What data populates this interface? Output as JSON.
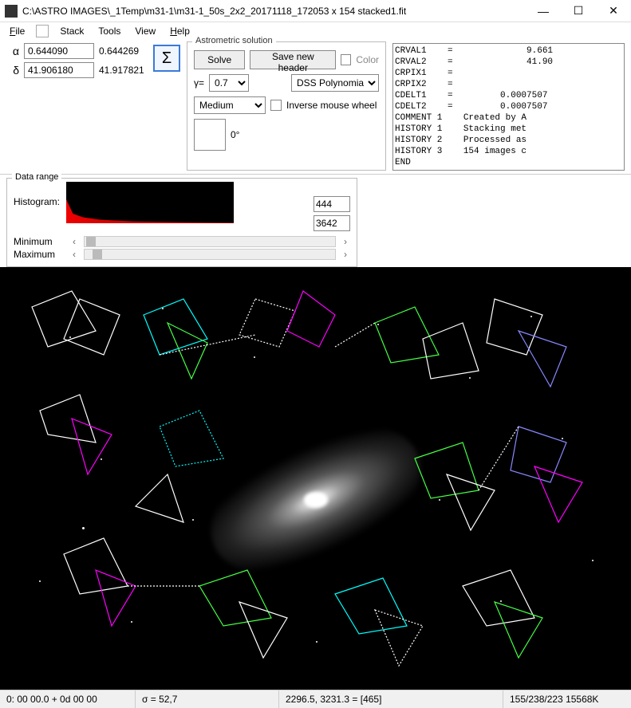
{
  "window": {
    "title": "C:\\ASTRO IMAGES\\_1Temp\\m31-1\\m31-1_50s_2x2_20171118_172053 x 154 stacked1.fit"
  },
  "menu": {
    "file": "File",
    "stack": "Stack",
    "tools": "Tools",
    "view": "View",
    "help": "Help"
  },
  "coords": {
    "alpha_sym": "α",
    "alpha_input": "0.644090",
    "alpha_val": "0.644269",
    "delta_sym": "δ",
    "delta_input": "41.906180",
    "delta_val": "41.917821"
  },
  "sigma": "Σ",
  "astro": {
    "legend": "Astrometric solution",
    "solve": "Solve",
    "save_header": "Save new header",
    "color": "Color",
    "fit_type": "DSS Polynomial",
    "gamma_label": "γ=",
    "gamma_val": "0.7",
    "quality": "Medium",
    "inverse": "Inverse mouse wheel",
    "rotation": "0°"
  },
  "fits_header": "CRVAL1    =              9.661\nCRVAL2    =              41.90\nCRPIX1    =\nCRPIX2    =\nCDELT1    =         0.0007507\nCDELT2    =         0.0007507\nCOMMENT 1    Created by A\nHISTORY 1    Stacking met\nHISTORY 2    Processed as\nHISTORY 3    154 images c\nEND",
  "datarange": {
    "legend": "Data range",
    "histogram": "Histogram:",
    "min_label": "Minimum",
    "max_label": "Maximum",
    "min_val": "444",
    "max_val": "3642"
  },
  "status": {
    "ra_dec": "0: 00  00.0   + 0d 00  00",
    "sigma": "σ = 52,7",
    "cursor": "2296.5, 3231.3 = [465]",
    "info": "155/238/223  15568K"
  }
}
